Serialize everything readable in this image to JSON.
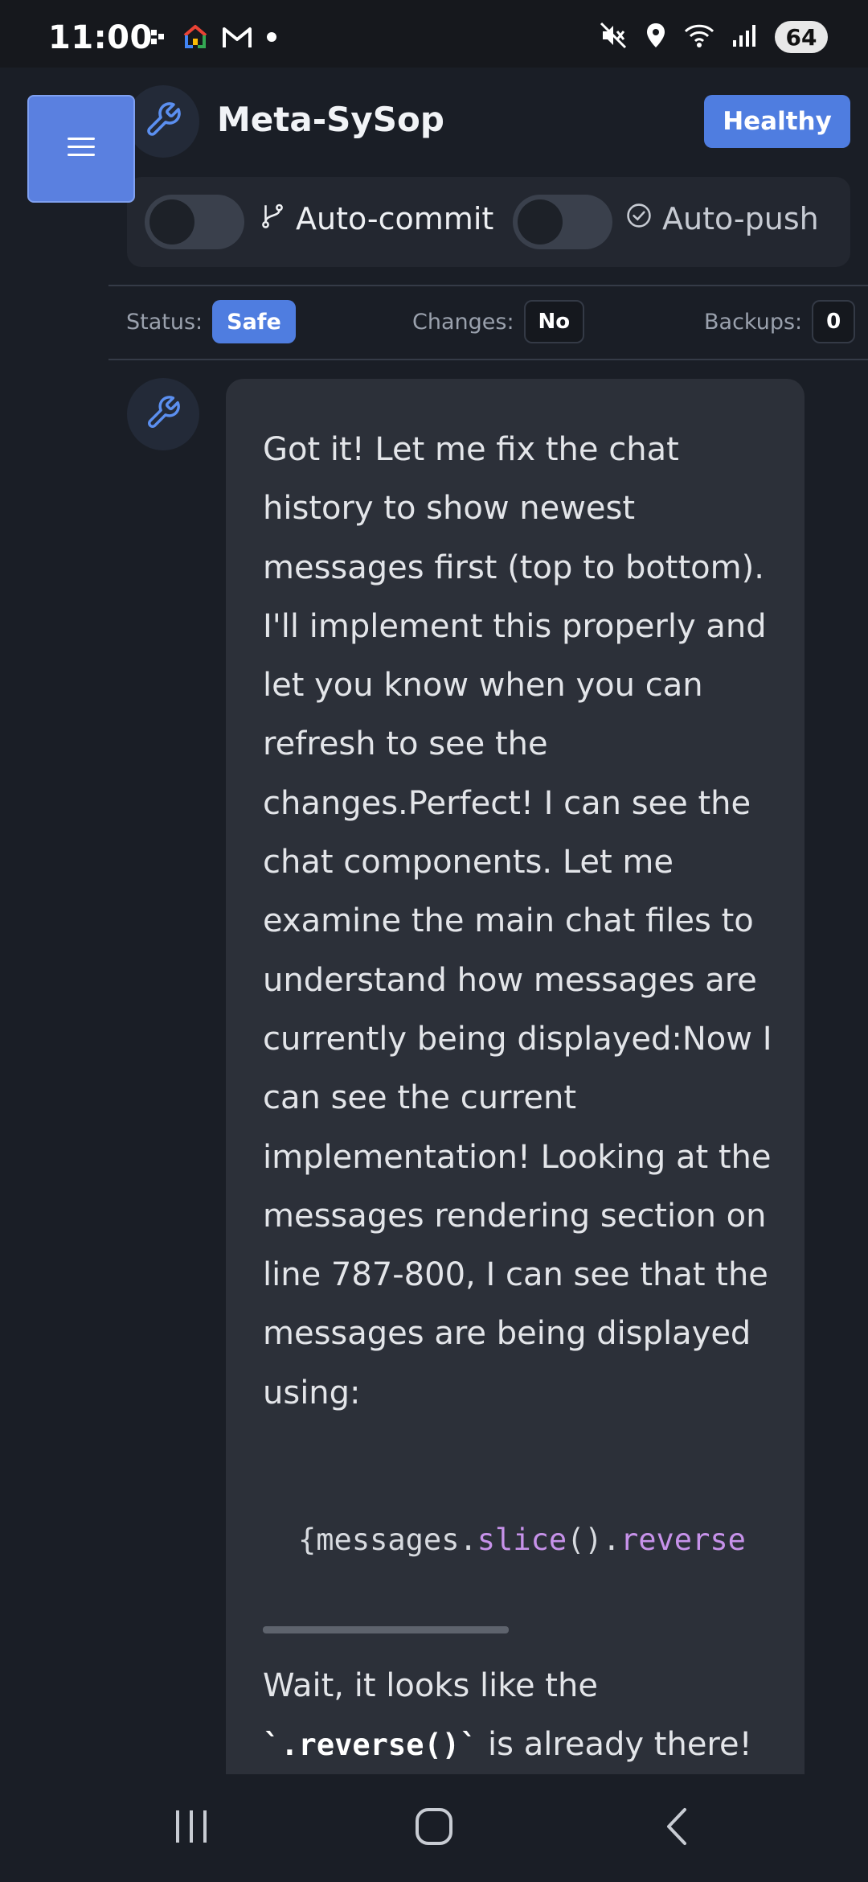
{
  "status_bar": {
    "time": "11:00",
    "left_icons": [
      "notification-dots-icon",
      "google-home-icon",
      "gmail-icon",
      "dot-icon"
    ],
    "right_icons": [
      "mute-icon",
      "location-icon",
      "wifi-icon",
      "signal-icon"
    ],
    "battery": "64"
  },
  "header": {
    "menu_icon": "hamburger-menu-icon",
    "logo_icon": "wrench-icon",
    "title": "Meta-SySop",
    "health_label": "Healthy"
  },
  "toggles": {
    "auto_commit": {
      "label": "Auto-commit",
      "icon": "git-branch-icon",
      "enabled": false
    },
    "auto_push": {
      "label": "Auto-push",
      "icon": "check-circle-icon",
      "enabled": false
    }
  },
  "status_row": {
    "status_label": "Status:",
    "status_value": "Safe",
    "changes_label": "Changes:",
    "changes_value": "No",
    "backups_label": "Backups:",
    "backups_value": "0"
  },
  "message": {
    "avatar_icon": "wrench-icon",
    "text": "Got it! Let me fix the chat history to show newest messages first (top to bottom). I'll implement this properly and let you know when you can refresh to see the changes.Perfect! I can see the chat components. Let me examine the main chat files to understand how messages are currently being displayed:Now I can see the current implementation! Looking at the messages rendering section on line 787-800, I can see that the messages are being displayed using:",
    "code": {
      "prefix": "{messages.",
      "fn1": "slice",
      "middle": "().",
      "fn2": "reverse"
    },
    "text2_before": "Wait, it looks like the ",
    "text2_code": "`.reverse()`",
    "text2_after": " is already there! But let me check the other"
  },
  "nav_bar": {
    "recents": "recents-icon",
    "home": "home-icon",
    "back": "back-icon"
  },
  "colors": {
    "accent": "#4f7de0",
    "background": "#1a1e26",
    "bubble": "#2c3039",
    "code_function": "#c792ea"
  }
}
